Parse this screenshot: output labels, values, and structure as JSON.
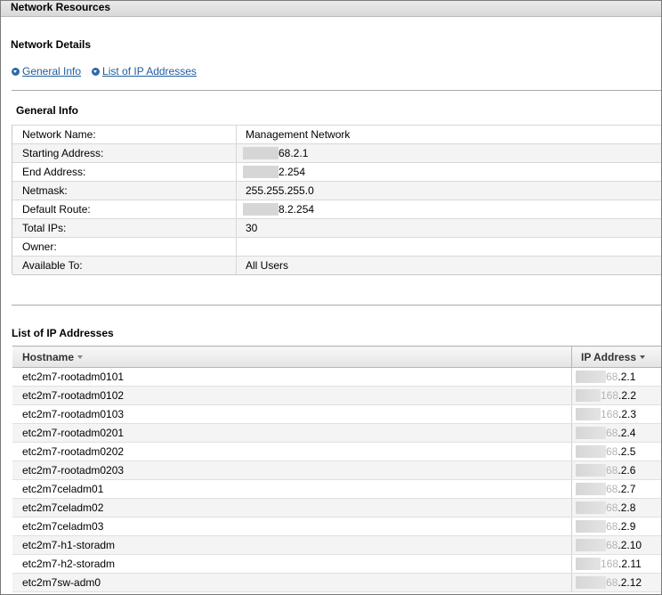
{
  "panel": {
    "title": "Network Resources"
  },
  "network_details": {
    "heading": "Network Details",
    "links": [
      {
        "label": "General Info",
        "icon": "chevron-down-circle-icon"
      },
      {
        "label": "List of IP Addresses",
        "icon": "chevron-down-circle-icon"
      }
    ]
  },
  "general_info": {
    "heading": "General Info",
    "rows": [
      {
        "key": "Network Name:",
        "value": "Management Network"
      },
      {
        "key": "Starting Address:",
        "value_masked": true,
        "value_tail": "68.2.1",
        "value_visible": ".2.1"
      },
      {
        "key": "End Address:",
        "value_masked": true,
        "value_tail": "2.254"
      },
      {
        "key": "Netmask:",
        "value": "255.255.255.0"
      },
      {
        "key": "Default Route:",
        "value_masked": true,
        "value_tail": "8.2.254"
      },
      {
        "key": "Total IPs:",
        "value": "30"
      },
      {
        "key": "Owner:",
        "value": ""
      },
      {
        "key": "Available To:",
        "value": "All Users"
      }
    ]
  },
  "ip_list": {
    "heading": "List of IP Addresses",
    "columns": {
      "hostname": "Hostname",
      "ip": "IP Address"
    },
    "rows": [
      {
        "hostname": "etc2m7-rootadm0101",
        "ip_faint": "68",
        "ip_tail": ".2.1"
      },
      {
        "hostname": "etc2m7-rootadm0102",
        "ip_faint": "168",
        "ip_tail": ".2.2"
      },
      {
        "hostname": "etc2m7-rootadm0103",
        "ip_faint": "168",
        "ip_tail": ".2.3"
      },
      {
        "hostname": "etc2m7-rootadm0201",
        "ip_faint": "68",
        "ip_tail": ".2.4"
      },
      {
        "hostname": "etc2m7-rootadm0202",
        "ip_faint": "68",
        "ip_tail": ".2.5"
      },
      {
        "hostname": "etc2m7-rootadm0203",
        "ip_faint": "68",
        "ip_tail": ".2.6"
      },
      {
        "hostname": "etc2m7celadm01",
        "ip_faint": "68",
        "ip_tail": ".2.7"
      },
      {
        "hostname": "etc2m7celadm02",
        "ip_faint": "68",
        "ip_tail": ".2.8"
      },
      {
        "hostname": "etc2m7celadm03",
        "ip_faint": "68",
        "ip_tail": ".2.9"
      },
      {
        "hostname": "etc2m7-h1-storadm",
        "ip_faint": "68",
        "ip_tail": ".2.10"
      },
      {
        "hostname": "etc2m7-h2-storadm",
        "ip_faint": "168",
        "ip_tail": ".2.11"
      },
      {
        "hostname": "etc2m7sw-adm0",
        "ip_faint": "68",
        "ip_tail": ".2.12"
      }
    ]
  }
}
